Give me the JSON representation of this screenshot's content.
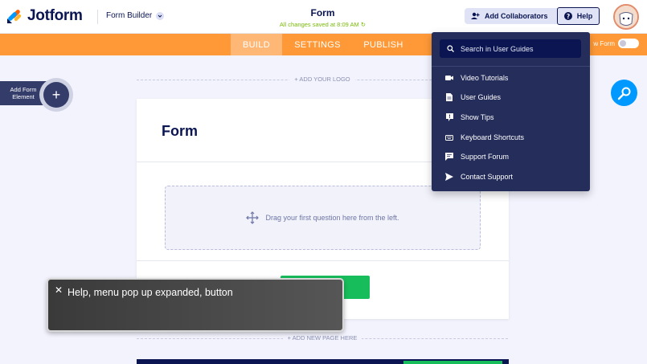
{
  "header": {
    "logo_text": "Jotform",
    "form_builder_label": "Form Builder",
    "form_title": "Form",
    "save_status": "All changes saved at 8:09 AM",
    "add_collaborators_label": "Add Collaborators",
    "help_label": "Help"
  },
  "tabs": [
    {
      "label": "BUILD",
      "active": true
    },
    {
      "label": "SETTINGS",
      "active": false
    },
    {
      "label": "PUBLISH",
      "active": false
    }
  ],
  "preview": {
    "label": "w Form"
  },
  "left_panel": {
    "add_element_label": "Add Form Element"
  },
  "builder": {
    "add_logo_label": "+ ADD YOUR LOGO",
    "form_heading": "Form",
    "dropzone_text": "Drag your first question here from the left.",
    "add_page_label": "+ ADD NEW PAGE HERE"
  },
  "help_menu": {
    "search_placeholder": "Search in User Guides",
    "items": [
      {
        "label": "Video Tutorials",
        "icon": "video-icon"
      },
      {
        "label": "User Guides",
        "icon": "document-icon"
      },
      {
        "label": "Show Tips",
        "icon": "tip-icon"
      },
      {
        "label": "Keyboard Shortcuts",
        "icon": "keyboard-icon"
      },
      {
        "label": "Support Forum",
        "icon": "chat-icon"
      },
      {
        "label": "Contact Support",
        "icon": "send-icon"
      }
    ]
  },
  "toast": {
    "message": "Help, menu pop up expanded, button"
  },
  "colors": {
    "navy": "#0a1551",
    "orange": "#ff9937",
    "green": "#18bd5b",
    "menu_bg": "#252d5b",
    "assist_blue": "#0099ff"
  }
}
